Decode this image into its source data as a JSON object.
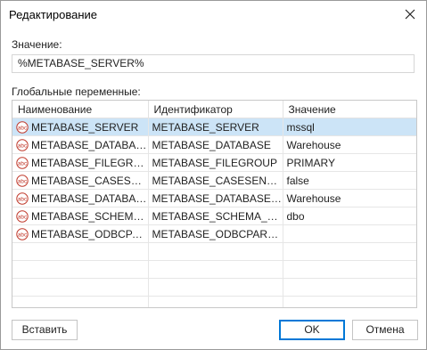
{
  "dialog": {
    "title": "Редактирование",
    "close_label": "close"
  },
  "value_field": {
    "label": "Значение:",
    "value": "%METABASE_SERVER%"
  },
  "globals": {
    "label": "Глобальные переменные:",
    "columns": [
      "Наименование",
      "Идентификатор",
      "Значение"
    ],
    "rows": [
      {
        "name": "METABASE_SERVER",
        "id": "METABASE_SERVER",
        "value": "mssql",
        "selected": true
      },
      {
        "name": "METABASE_DATABASE",
        "id": "METABASE_DATABASE",
        "value": "Warehouse"
      },
      {
        "name": "METABASE_FILEGROUP",
        "id": "METABASE_FILEGROUP",
        "value": "PRIMARY"
      },
      {
        "name": "METABASE_CASESENS...",
        "id": "METABASE_CASESENSITIVE",
        "value": "false"
      },
      {
        "name": "METABASE_DATABASE...",
        "id": "METABASE_DATABASE_ONLY",
        "value": "Warehouse"
      },
      {
        "name": "METABASE_SCHEMA_...",
        "id": "METABASE_SCHEMA_ONLY",
        "value": "dbo"
      },
      {
        "name": "METABASE_ODBCPAR...",
        "id": "METABASE_ODBCPARAMS",
        "value": ""
      }
    ],
    "row_icon": "abc-text-icon",
    "icon_color": "#c0392b",
    "selected_row_color": "#cce4f7"
  },
  "buttons": {
    "insert": "Вставить",
    "ok": "OK",
    "cancel": "Отмена"
  },
  "colors": {
    "accent": "#0078d7",
    "border": "#c8c8c8"
  }
}
